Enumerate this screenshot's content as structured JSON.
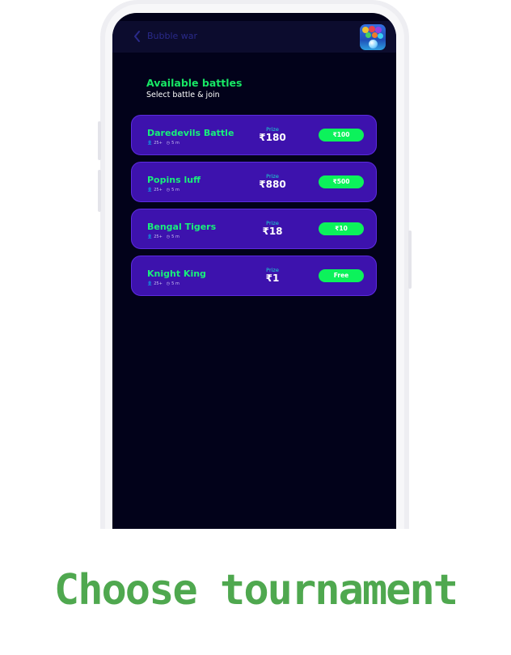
{
  "appbar": {
    "title": "Bubble war"
  },
  "section": {
    "heading": "Available battles",
    "subheading": "Select battle & join"
  },
  "battles": [
    {
      "name": "Daredevils Battle",
      "players": "25+",
      "duration": "5 m",
      "prize_label": "Prize",
      "prize": "₹180",
      "button": "₹100"
    },
    {
      "name": "Popins luff",
      "players": "25+",
      "duration": "5 m",
      "prize_label": "Prize",
      "prize": "₹880",
      "button": "₹500"
    },
    {
      "name": "Bengal Tigers",
      "players": "25+",
      "duration": "5 m",
      "prize_label": "Prize",
      "prize": "₹18",
      "button": "₹10"
    },
    {
      "name": "Knight King",
      "players": "25+",
      "duration": "5 m",
      "prize_label": "Prize",
      "prize": "₹1",
      "button": "Free"
    }
  ],
  "caption": "Choose tournament",
  "colors": {
    "accent_green": "#17e865",
    "card_purple": "#3d12ad",
    "screen_bg": "#02021a",
    "caption_green": "#4fa84f"
  },
  "icons": {
    "back": "chevron-left-icon",
    "app": "bubble-shooter-app-icon",
    "players": "user-icon",
    "time": "clock-icon"
  }
}
